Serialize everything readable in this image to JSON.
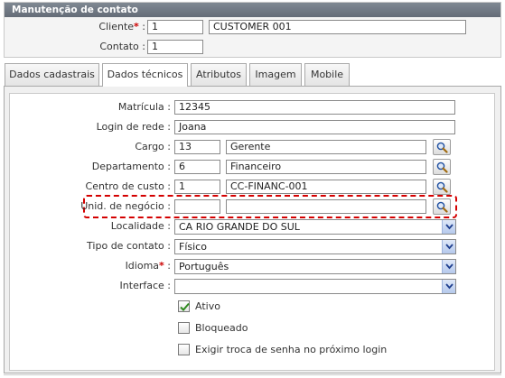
{
  "panel_title": "Manutenção de contato",
  "header": {
    "cliente_label": "Cliente",
    "cliente_required": "*",
    "cliente_colon": " :",
    "cliente_code": "1",
    "cliente_name": "CUSTOMER 001",
    "contato_label": "Contato :",
    "contato_value": "1"
  },
  "tabs": [
    "Dados cadastrais",
    "Dados técnicos",
    "Atributos",
    "Imagem",
    "Mobile"
  ],
  "active_tab": "Dados técnicos",
  "form": {
    "matricula": {
      "label": "Matrícula :",
      "value": "12345"
    },
    "login": {
      "label": "Login de rede :",
      "value": "Joana"
    },
    "cargo": {
      "label": "Cargo :",
      "code": "13",
      "description": "Gerente"
    },
    "departamento": {
      "label": "Departamento :",
      "code": "6",
      "description": "Financeiro"
    },
    "centro_custo": {
      "label": "Centro de custo :",
      "code": "1",
      "description": "CC-FINANC-001"
    },
    "unid_negocio": {
      "label": "Unid. de negócio :",
      "code": "",
      "description": ""
    },
    "localidade": {
      "label": "Localidade :",
      "value": "CA RIO GRANDE DO SUL"
    },
    "tipo_contato": {
      "label": "Tipo de contato :",
      "value": "Físico"
    },
    "idioma": {
      "label": "Idioma",
      "required": "*",
      "colon": " :",
      "value": "Português"
    },
    "interface": {
      "label": "Interface :",
      "value": ""
    }
  },
  "checkboxes": [
    {
      "label": "Ativo",
      "checked": true
    },
    {
      "label": "Bloqueado",
      "checked": false
    },
    {
      "label": "Exigir troca de senha no próximo login",
      "checked": false
    }
  ],
  "icons": {
    "lookup": "magnifier-search-icon",
    "dropdown": "chevron-down-icon",
    "check": "checkmark-icon"
  },
  "colors": {
    "header_bar": "#646c77",
    "required_mark": "#cc0000",
    "highlight_dash": "#d40000",
    "checkmark": "#2f8a1f",
    "select_arrow": "#1f3f8f"
  }
}
